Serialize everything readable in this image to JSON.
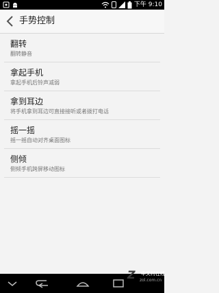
{
  "status_bar": {
    "time": "下午 9:10"
  },
  "header": {
    "title": "手势控制"
  },
  "items": [
    {
      "title": "翻转",
      "subtitle": "翻转静音"
    },
    {
      "title": "拿起手机",
      "subtitle": "拿起手机后铃声减弱"
    },
    {
      "title": "拿到耳边",
      "subtitle": "将手机拿到耳边可直接接听或者拨打电话"
    },
    {
      "title": "摇一摇",
      "subtitle": "摇一摇自动对齐桌面图标"
    },
    {
      "title": "侧倾",
      "subtitle": "侧倾手机跨屏移动图标"
    }
  ],
  "watermark": {
    "brand": "中关村在线",
    "url": "zol.com.cn"
  },
  "colors": {
    "background": "#f3f3f3",
    "status_bar": "#000000",
    "nav_bar": "#000000",
    "text_primary": "#222222",
    "text_secondary": "#777777"
  }
}
